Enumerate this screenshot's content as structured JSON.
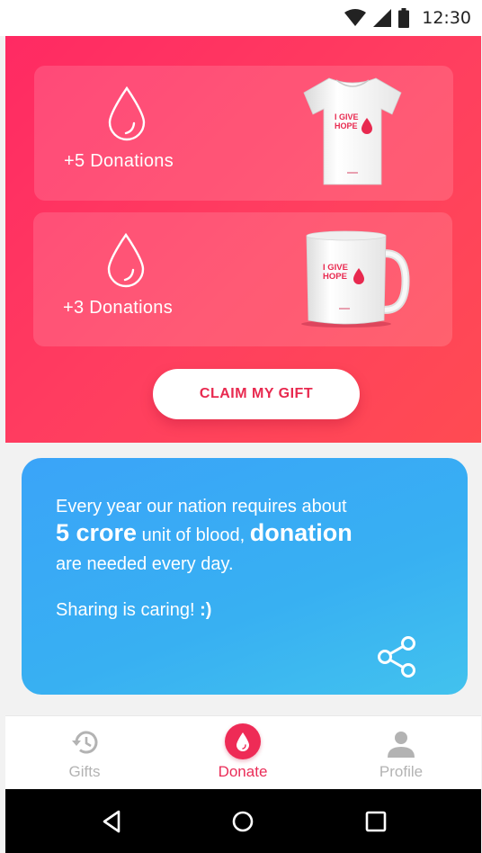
{
  "status_bar": {
    "time": "12:30",
    "icons": [
      "wifi-icon",
      "signal-icon",
      "battery-icon"
    ]
  },
  "gifts": [
    {
      "label": "+5 Donations",
      "icon": "blood-drop-icon",
      "item": "tshirt",
      "item_text": "I GIVE HOPE"
    },
    {
      "label": "+3 Donations",
      "icon": "blood-drop-icon",
      "item": "mug",
      "item_text": "I GIVE HOPE"
    }
  ],
  "claim_button": "CLAIM MY GIFT",
  "info": {
    "line1": "Every year our nation requires about",
    "line2_big1": "5 crore",
    "line2_mid": "unit of blood,",
    "line2_big2": "donation",
    "line3": "are needed every day.",
    "line4_text": "Sharing is caring!",
    "line4_bold": ":)"
  },
  "nav": {
    "items": [
      {
        "label": "Gifts",
        "icon": "history-icon",
        "active": false
      },
      {
        "label": "Donate",
        "icon": "blood-drop-icon",
        "active": true
      },
      {
        "label": "Profile",
        "icon": "person-icon",
        "active": false
      }
    ]
  },
  "colors": {
    "brand_pink": "#ff2a63",
    "info_blue": "#3aa4f8",
    "active_nav": "#ea2d58",
    "inactive_nav": "#b3b3b3"
  }
}
